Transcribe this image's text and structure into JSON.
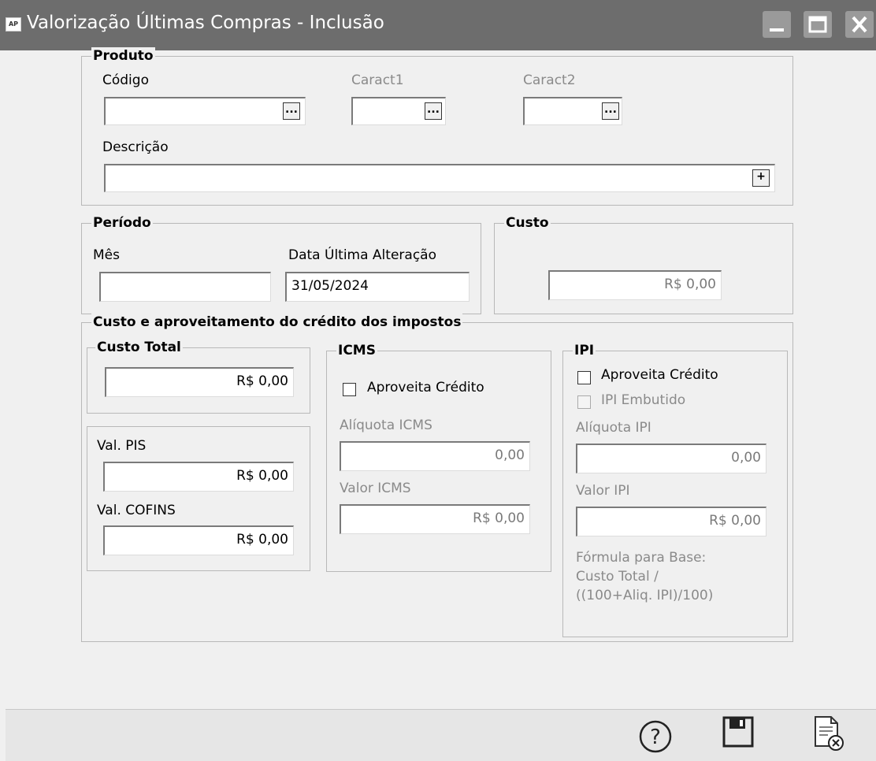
{
  "window": {
    "app_icon_text": "AP",
    "title": "Valorização Últimas Compras - Inclusão"
  },
  "produto": {
    "legend": "Produto",
    "codigo_label": "Código",
    "codigo_value": "",
    "caract1_label": "Caract1",
    "caract1_value": "",
    "caract2_label": "Caract2",
    "caract2_value": "",
    "descricao_label": "Descrição",
    "descricao_value": "",
    "lookup_button": "...",
    "add_button": "+"
  },
  "periodo": {
    "legend": "Período",
    "mes_label": "Mês",
    "mes_value": "",
    "data_label": "Data Última Alteração",
    "data_value": "31/05/2024"
  },
  "custo": {
    "legend": "Custo",
    "value": "R$ 0,00"
  },
  "impostos": {
    "legend": "Custo e aproveitamento do crédito dos impostos",
    "custo_total": {
      "legend": "Custo Total",
      "value": "R$ 0,00"
    },
    "pis_label": "Val. PIS",
    "pis_value": "R$ 0,00",
    "cofins_label": "Val. COFINS",
    "cofins_value": "R$ 0,00",
    "icms": {
      "legend": "ICMS",
      "aproveita_label": "Aproveita Crédito",
      "aliquota_label": "Alíquota ICMS",
      "aliquota_value": "0,00",
      "valor_label": "Valor ICMS",
      "valor_value": "R$ 0,00"
    },
    "ipi": {
      "legend": "IPI",
      "aproveita_label": "Aproveita Crédito",
      "embutido_label": "IPI Embutido",
      "aliquota_label": "Alíquota IPI",
      "aliquota_value": "0,00",
      "valor_label": "Valor IPI",
      "valor_value": "R$ 0,00",
      "formula_line1": "Fórmula para Base:",
      "formula_line2": "Custo Total /",
      "formula_line3": "((100+Aliq. IPI)/100)"
    }
  },
  "status_icons": [
    "help-icon",
    "save-icon",
    "cancel-document-icon"
  ]
}
